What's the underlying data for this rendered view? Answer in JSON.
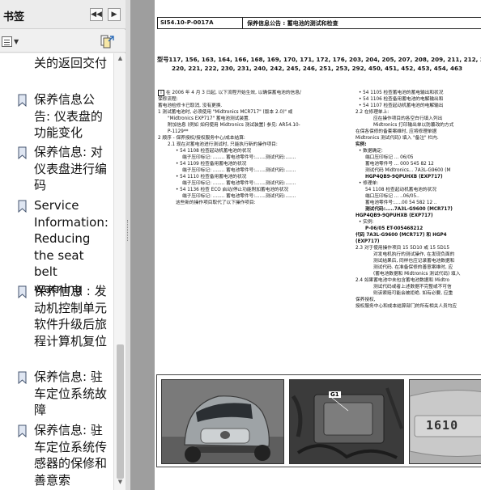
{
  "bookmarks_panel": {
    "title": "书签",
    "collapse_icon": "double-left-arrow-icon",
    "next_icon": "right-arrow-icon",
    "options_icon": "bookmark-options-icon",
    "expand_icon": "expand-current-bookmark-icon",
    "items": [
      {
        "label": "关的返回交付",
        "icon": "none"
      },
      {
        "label": "保养信息公告: 仪表盘的功能变化",
        "icon": "bookmark-icon"
      },
      {
        "label": "保养信息: 对仪表盘进行编码",
        "icon": "bookmark-icon"
      },
      {
        "label": "Service Information: Reducing the seat belt warning",
        "icon": "bookmark-icon"
      },
      {
        "label": "保养信息 : 发动机控制单元软件升级后旅程计算机复位",
        "icon": "bookmark-icon"
      },
      {
        "label": "保养信息: 驻车定位系统故障",
        "icon": "bookmark-icon"
      },
      {
        "label": "保养信息: 驻车定位系统传感器的保修和善意索",
        "icon": "bookmark-icon"
      }
    ]
  },
  "document": {
    "header_id": "SI54.10-P-0017A",
    "header_title": "保养信息公告 : 蓄电池的测试和检查",
    "models_line1": "型号117, 156, 163, 164, 166, 168, 169, 170, 171, 172, 176, 203, 204, 205, 207, 208, 209, 211, 212, 215, 216, 2",
    "models_line2": "220, 221, 222, 230, 231, 240, 242, 245, 246, 251, 253, 292, 450, 451, 452, 453, 454, 463",
    "left_column": [
      {
        "t": "在 2006 年 4 月 3 日起, 以下流程开始生效, 以确保蓄电池的信息/",
        "cls": "",
        "box": "i"
      },
      {
        "t": "保修流程:",
        "cls": ""
      },
      {
        "t": "蓄电池检修卡已取消, 没有更换.",
        "cls": ""
      },
      {
        "t": "1   测试蓄电池时, 必须使用 \"Midtronics MCR717\" (版本 2.0)\" 或",
        "cls": ""
      },
      {
        "t": "\"Midtronics EXP717\" 蓄电池测试装置.",
        "cls": "i2"
      },
      {
        "t": "附加信息 (例如 如何使用 Midtronics 测试装置) 参见: AR54.10-",
        "cls": "i2"
      },
      {
        "t": "P-1129**",
        "cls": "i2"
      },
      {
        "t": "2   顺序 - 保养授权/授权服务中心/成本结算:",
        "cls": ""
      },
      {
        "t": "2.1      现在对蓄电池进行测试时, 只能执行新的操作项目:",
        "cls": "i2"
      },
      {
        "t": "•     54 1108 检查起动机蓄电池的状况",
        "cls": "i3"
      },
      {
        "t": "端子压印标记: ........ 蓄电池零件号:.......测试代码:.......",
        "cls": "i4"
      },
      {
        "t": "•     54 1109 检查备用蓄电池的状况",
        "cls": "i3"
      },
      {
        "t": "端子压印标记: ........ 蓄电池零件号:.......测试代码:.......",
        "cls": "i4"
      },
      {
        "t": "•     54 1110 检查备用蓄电池的状况",
        "cls": "i3"
      },
      {
        "t": "端子压印标记: ........ 蓄电池零件号:.......测试代码:.......",
        "cls": "i4"
      },
      {
        "t": "•     54 1136 检查 ECO 启动/停止功能附加蓄电池的状况",
        "cls": "i3"
      },
      {
        "t": "端子压印标记: ........ 蓄电池零件号:.......测试代码:.......",
        "cls": "i4"
      },
      {
        "t": "这些新的操作项目取代了以下操作项目:",
        "cls": "i3"
      }
    ],
    "right_column": [
      {
        "t": "•     54 1105 检查蓄电池的蓄电输出和状况",
        "cls": "i1"
      },
      {
        "t": "•     54 1106 检查备用蓄电池的电解输出和",
        "cls": "i1"
      },
      {
        "t": "•     54 1107 检查起动机蓄电池的电解输出",
        "cls": "i1"
      },
      {
        "t": "2.2      在修理单上:",
        "cls": ""
      },
      {
        "t": "应在操作项目的各空白行填入列出",
        "cls": "i3"
      },
      {
        "t": "Midtronics 打印输出单以防篡改的方式",
        "cls": "i3"
      },
      {
        "t": "在保各保修的备套案维时, 应将修理单据",
        "cls": ""
      },
      {
        "t": "Midtronics 测试代码) 填入 \"备注\" 栏内.",
        "cls": ""
      },
      {
        "t": "实例:",
        "cls": "b"
      },
      {
        "t": "•   数据确定:",
        "cls": "i1"
      },
      {
        "t": "端口压印标记 ... 06/05",
        "cls": "i2"
      },
      {
        "t": "蓄电池零件号 ... 000 545 82 12",
        "cls": "i2"
      },
      {
        "t": "测试代码 Midtronics... 7A3L-G9600 (M",
        "cls": "i2"
      },
      {
        "t": "HGP4QB9-9QPUHXB (EXP717)",
        "cls": "i2 b"
      },
      {
        "t": "•   修理单:",
        "cls": "i1"
      },
      {
        "t": "54 1108 检查起动机蓄电池的状况",
        "cls": "i2"
      },
      {
        "t": "端口压印标记 ... ..06/05..",
        "cls": "i2"
      },
      {
        "t": "蓄电池零件号:.....00 54 582 12 ..",
        "cls": "i2"
      },
      {
        "t": "测试代码:.....7A3L-G9600 (MCR717)",
        "cls": "i2 b"
      },
      {
        "t": "HGP4QB9-9QPUHXB (EXP717)",
        "cls": "b"
      },
      {
        "t": "•   实例:",
        "cls": "i1"
      },
      {
        "t": "P-06/05 ET-005468212",
        "cls": "i2 b"
      },
      {
        "t": "代码 7A3L-G9600 (MCR717) 和 HGP4",
        "cls": "b"
      },
      {
        "t": "(EXP717)",
        "cls": "b"
      },
      {
        "t": "2.3      对于使用操作项目 15 5D10 或 15 5D15",
        "cls": ""
      },
      {
        "t": "对发电机执行的测试操作, 在发现负面的",
        "cls": "i3"
      },
      {
        "t": "测试结果后, 同样也应记录蓄电池数据和",
        "cls": "i3"
      },
      {
        "t": "测试代码. 在准备保修的善意案维时, 应",
        "cls": "i3"
      },
      {
        "t": "(蓄电池数据和 Midtronics 测试代码) 填入",
        "cls": "i3"
      },
      {
        "t": "2.4      如果蓄电池中未包含蓄电池数据和 Midtro",
        "cls": ""
      },
      {
        "t": "测试代码或者上述数据不完整或不可信",
        "cls": "i3"
      },
      {
        "t": "则该索赔可能会被拒绝. 如有必要, 应重",
        "cls": "i3"
      },
      {
        "t": "保养授权,",
        "cls": ""
      },
      {
        "t": "授权服务中心和成本结算部门的所有相关人员均应",
        "cls": ""
      }
    ],
    "figure_label": "G1",
    "plate_text": "1610"
  }
}
